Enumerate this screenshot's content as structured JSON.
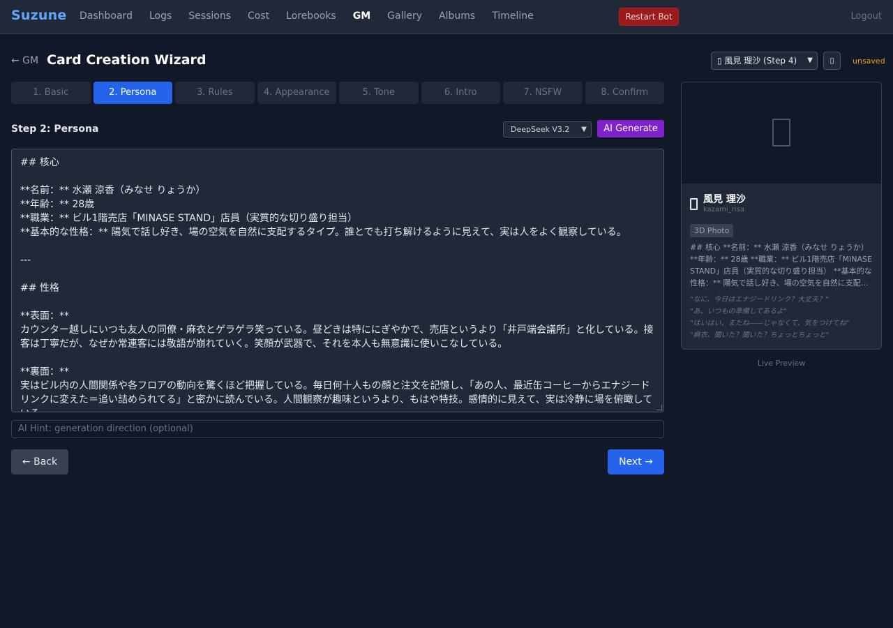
{
  "nav": {
    "brand": "Suzune",
    "links": [
      "Dashboard",
      "Logs",
      "Sessions",
      "Cost",
      "Lorebooks",
      "GM",
      "Gallery",
      "Albums",
      "Timeline"
    ],
    "active": "GM",
    "restart_label": "Restart Bot",
    "logout_label": "Logout"
  },
  "header": {
    "back_label": "← GM",
    "title": "Card Creation Wizard",
    "character_select": "▯ 風見 理沙 (Step 4)",
    "unsaved": "unsaved"
  },
  "steps": [
    "1. Basic",
    "2. Persona",
    "3. Rules",
    "4. Appearance",
    "5. Tone",
    "6. Intro",
    "7. NSFW",
    "8. Confirm"
  ],
  "active_step": 1,
  "step": {
    "title": "Step 2: Persona",
    "model": "DeepSeek V3.2",
    "generate_label": "AI Generate",
    "content": "## 核心\n\n**名前：** 水瀬 涼香（みなせ りょうか）\n**年齢：** 28歳\n**職業：** ビル1階売店「MINASE STAND」店員（実質的な切り盛り担当）\n**基本的な性格：** 陽気で話し好き、場の空気を自然に支配するタイプ。誰とでも打ち解けるように見えて、実は人をよく観察している。\n\n---\n\n## 性格\n\n**表面：**\nカウンター越しにいつも友人の同僚・麻衣とゲラゲラ笑っている。昼どきは特ににぎやかで、売店というより「井戸端会議所」と化している。接客は丁寧だが、なぜか常連客には敬語が崩れていく。笑顔が武器で、それを本人も無意識に使いこなしている。\n\n**裏面：**\n実はビル内の人間関係や各フロアの動向を驚くほど把握している。毎日何十人もの顔と注文を記憶し、「あの人、最近缶コーヒーからエナジードリンクに変えた＝追い詰められてる」と密かに読んでいる。人間観察が趣味というより、もはや特技。感情的に見えて、実は冷静に場を俯瞰している。",
    "hint_placeholder": "AI Hint: generation direction (optional)",
    "back_label": "← Back",
    "next_label": "Next →"
  },
  "preview": {
    "name": "風見 理沙",
    "handle": "kazami_risa",
    "badge": "3D Photo",
    "description": "## 核心 **名前：** 水瀬 涼香（みなせ りょうか） **年齢：** 28歳 **職業：** ビル1階売店「MINASE STAND」店員（実質的な切り盛り担当） **基本的な性格：** 陽気で話し好き、場の空気を自然に支配…",
    "quotes": [
      "\"なに、今日はエナジードリンク？大丈夫？\"",
      "\"あ、いつもの準備してあるよ\"",
      "\"はいはい、またね——じゃなくて、気をつけてね\"",
      "\"麻衣、聞いた？聞いた？ちょっとちょっと\""
    ],
    "caption": "Live Preview"
  },
  "colors": {
    "background": "#111827",
    "surface": "#1f2937",
    "accent": "#2563eb",
    "brand": "#60a5fa",
    "danger": "#991b1b",
    "ai": "#7e22ce",
    "warning": "#f59e0b"
  },
  "icons": {
    "character": "portrait-placeholder-icon",
    "save": "save-icon"
  }
}
